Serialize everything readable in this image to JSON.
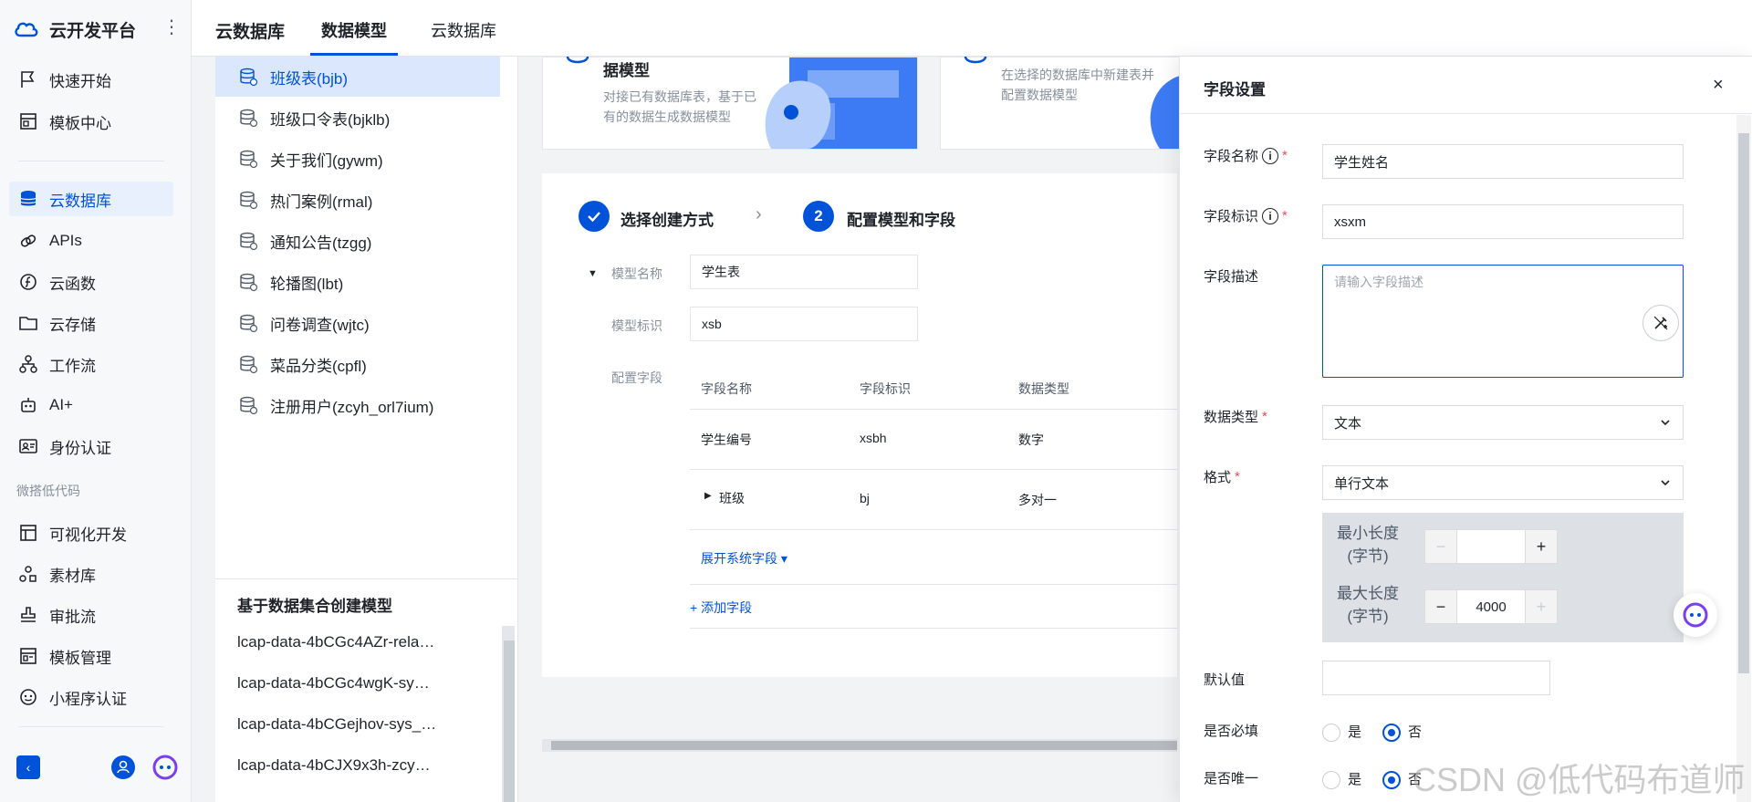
{
  "app": {
    "brand": "云开发平台",
    "more_icon": "⋮"
  },
  "nav": {
    "items": [
      {
        "label": "快速开始",
        "icon": "flag-icon"
      },
      {
        "label": "模板中心",
        "icon": "template-icon"
      },
      {
        "label": "云数据库",
        "icon": "database-icon",
        "active": true
      },
      {
        "label": "APIs",
        "icon": "link-icon"
      },
      {
        "label": "云函数",
        "icon": "function-icon"
      },
      {
        "label": "云存储",
        "icon": "folder-icon"
      },
      {
        "label": "工作流",
        "icon": "workflow-icon"
      },
      {
        "label": "AI+",
        "icon": "robot-icon"
      },
      {
        "label": "身份认证",
        "icon": "id-card-icon"
      }
    ],
    "group_title": "微搭低代码",
    "group_items": [
      {
        "label": "可视化开发",
        "icon": "layout-icon"
      },
      {
        "label": "素材库",
        "icon": "assets-icon"
      },
      {
        "label": "审批流",
        "icon": "stamp-icon"
      },
      {
        "label": "模板管理",
        "icon": "template-manage-icon"
      },
      {
        "label": "小程序认证",
        "icon": "miniapp-icon"
      }
    ],
    "collapse_icon": "‹"
  },
  "header": {
    "title": "云数据库",
    "tabs": [
      {
        "label": "数据模型",
        "active": true
      },
      {
        "label": "云数据库",
        "active": false
      }
    ]
  },
  "model_list": {
    "items": [
      {
        "label": "班级表(bjb)",
        "active": true
      },
      {
        "label": "班级口令表(bjklb)"
      },
      {
        "label": "关于我们(gywm)"
      },
      {
        "label": "热门案例(rmal)"
      },
      {
        "label": "通知公告(tzgg)"
      },
      {
        "label": "轮播图(lbt)"
      },
      {
        "label": "问卷调查(wjtc)"
      },
      {
        "label": "菜品分类(cpfl)"
      },
      {
        "label": "注册用户(zcyh_orl7ium)"
      }
    ],
    "section_title": "基于数据集合创建模型",
    "collections": [
      "lcap-data-4bCGc4AZr-rela…",
      "lcap-data-4bCGc4wgK-sy…",
      "lcap-data-4bCGejhov-sys_…",
      "lcap-data-4bCJX9x3h-zcy…"
    ]
  },
  "cards": [
    {
      "title": "据模型",
      "desc": [
        "对接已有数据库表，基于已",
        "有的数据生成数据模型"
      ]
    },
    {
      "title": "",
      "desc": [
        "在选择的数据库中新建表并",
        "配置数据模型"
      ]
    }
  ],
  "wizard": {
    "step1": "选择创建方式",
    "step2_num": "2",
    "step2": "配置模型和字段",
    "model_name_label": "模型名称",
    "model_name_value": "学生表",
    "model_id_label": "模型标识",
    "model_id_value": "xsb",
    "fields_label": "配置字段",
    "columns": [
      "字段名称",
      "字段标识",
      "数据类型"
    ],
    "rows": [
      {
        "name": "学生编号",
        "id": "xsbh",
        "type": "数字"
      },
      {
        "name": "班级",
        "id": "bj",
        "type": "多对一"
      }
    ],
    "expand_system": "展开系统字段 ▾",
    "add_field": "+ 添加字段"
  },
  "drawer": {
    "title": "字段设置",
    "close": "×",
    "field_name_label": "字段名称",
    "field_name_value": "学生姓名",
    "field_id_label": "字段标识",
    "field_id_value": "xsxm",
    "desc_label": "字段描述",
    "desc_placeholder": "请输入字段描述",
    "data_type_label": "数据类型",
    "data_type_value": "文本",
    "format_label": "格式",
    "format_value": "单行文本",
    "min_len_label": "最小长度(字节)",
    "min_len_value": "",
    "max_len_label": "最大长度(字节)",
    "max_len_value": "4000",
    "default_label": "默认值",
    "default_value": "",
    "required_label": "是否必填",
    "unique_label": "是否唯一",
    "yes": "是",
    "no": "否"
  },
  "watermark": "CSDN @低代码布道师",
  "colors": {
    "accent": "#0052d9",
    "active_bg": "#dbe7fd",
    "required": "#e34d59"
  }
}
